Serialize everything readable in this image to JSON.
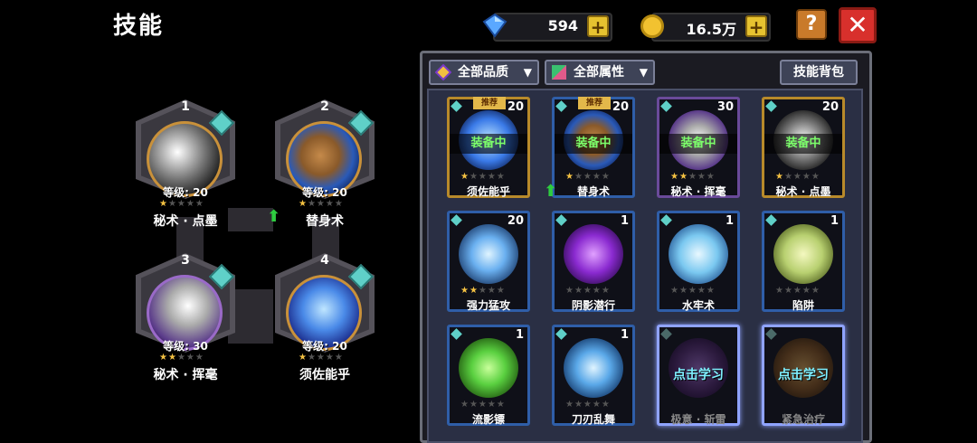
{
  "title": "技能",
  "currency": {
    "gems": "594",
    "gold": "16.5万",
    "help_label": "?",
    "close_label": "✕"
  },
  "equipped": [
    {
      "slot": "1",
      "level": "等级: 20",
      "name": "秘术 · 点墨",
      "stars": 1
    },
    {
      "slot": "2",
      "level": "等级: 20",
      "name": "替身术",
      "stars": 1
    },
    {
      "slot": "3",
      "level": "等级: 30",
      "name": "秘术 · 挥毫",
      "stars": 2
    },
    {
      "slot": "4",
      "level": "等级: 20",
      "name": "须佐能乎",
      "stars": 1
    }
  ],
  "filters": {
    "quality": "全部品质",
    "attribute": "全部属性",
    "bag": "技能背包"
  },
  "labels": {
    "equipped": "装备中",
    "recommended": "推荐",
    "learn": "点击学习"
  },
  "skills": [
    {
      "name": "须佐能乎",
      "count": "20",
      "stars": 1,
      "equipped": true,
      "recommended": true
    },
    {
      "name": "替身术",
      "count": "20",
      "stars": 1,
      "equipped": true,
      "recommended": true
    },
    {
      "name": "秘术 · 挥毫",
      "count": "30",
      "stars": 2,
      "equipped": true
    },
    {
      "name": "秘术 · 点墨",
      "count": "20",
      "stars": 1,
      "equipped": true
    },
    {
      "name": "强力猛攻",
      "count": "20",
      "stars": 2
    },
    {
      "name": "阴影潜行",
      "count": "1",
      "stars": 0
    },
    {
      "name": "水牢术",
      "count": "1",
      "stars": 0
    },
    {
      "name": "陷阱",
      "count": "1",
      "stars": 0
    },
    {
      "name": "流影镖",
      "count": "1",
      "stars": 0
    },
    {
      "name": "刀刃乱舞",
      "count": "1",
      "stars": 0
    },
    {
      "name": "极意 · 斩雷",
      "learn": true
    },
    {
      "name": "紧急治疗",
      "learn": true
    }
  ],
  "colors": {
    "accent_gold": "#e6c230",
    "close_red": "#d8302c",
    "equipped_green": "#7cff6a"
  }
}
